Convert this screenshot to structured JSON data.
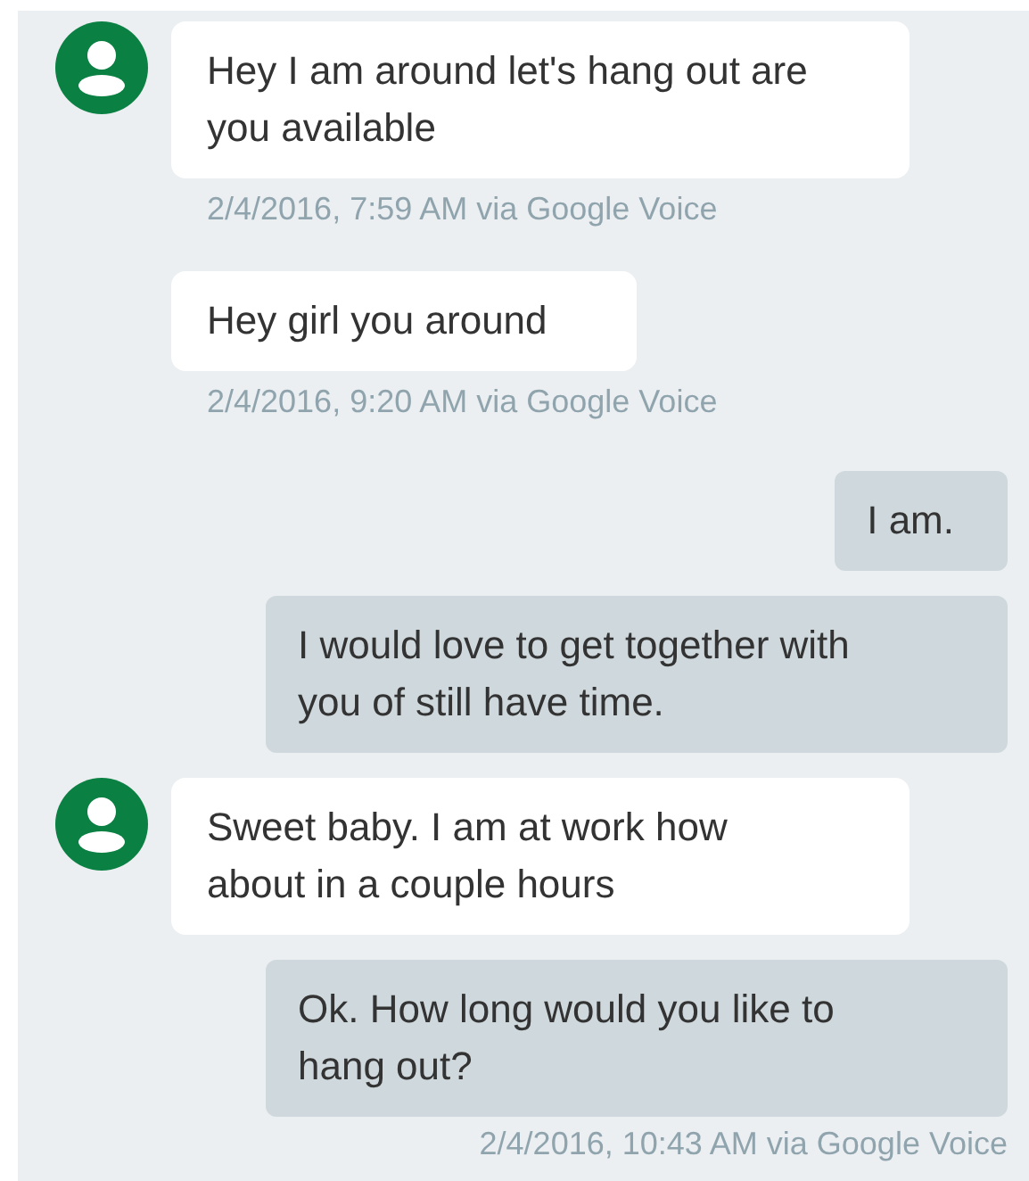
{
  "messages": [
    {
      "kind": "incoming",
      "avatar": true,
      "text": "Hey I am around let's hang out are you available",
      "timestamp": "2/4/2016, 7:59 AM via Google Voice"
    },
    {
      "kind": "incoming",
      "avatar": false,
      "text": "Hey girl you around",
      "timestamp": "2/4/2016, 9:20 AM via Google Voice"
    },
    {
      "kind": "outgoing",
      "text": "I am."
    },
    {
      "kind": "outgoing",
      "text": "I would love to get together with you of still have time."
    },
    {
      "kind": "incoming",
      "avatar": true,
      "text": "Sweet baby. I am at work how about in a couple hours"
    },
    {
      "kind": "outgoing",
      "text": "Ok. How long would you like to hang out?",
      "timestamp": "2/4/2016, 10:43 AM via Google Voice"
    }
  ]
}
